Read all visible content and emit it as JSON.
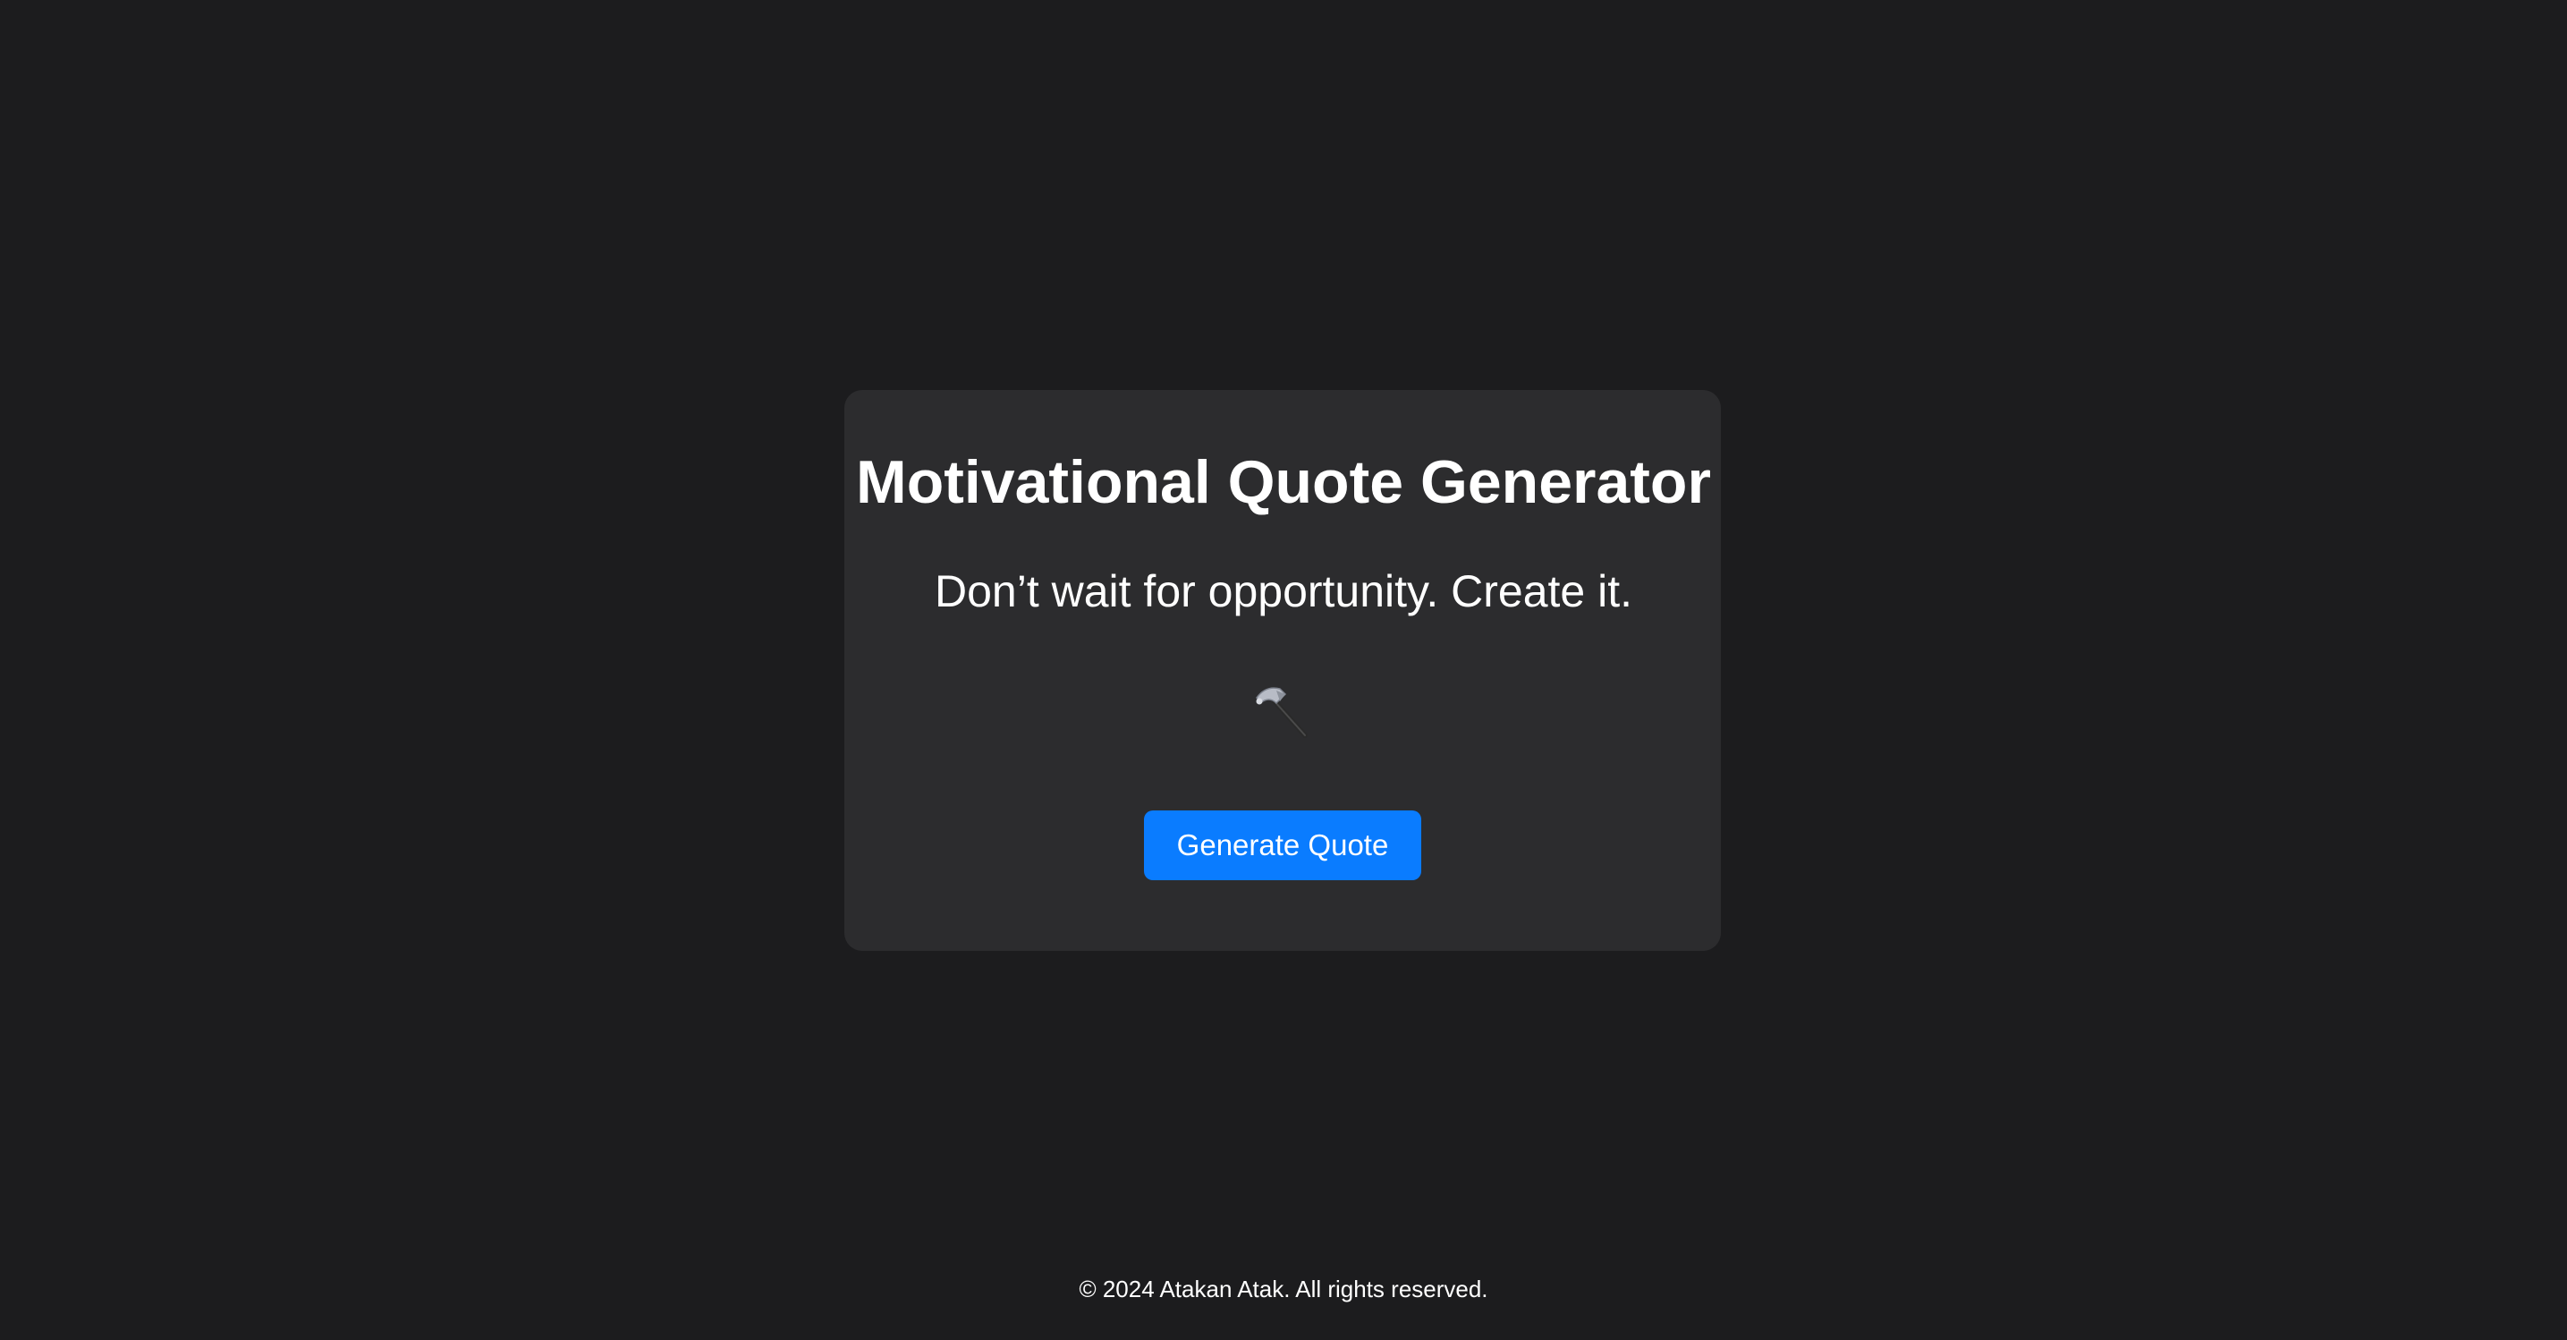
{
  "header": {
    "title": "Motivational Quote Generator"
  },
  "quote": {
    "text": "Don’t wait for opportunity. Create it.",
    "icon": "hammer-icon"
  },
  "actions": {
    "generate_label": "Generate Quote"
  },
  "footer": {
    "copyright": "© 2024 Atakan Atak. All rights reserved."
  },
  "colors": {
    "background": "#1c1c1e",
    "card": "#2c2c2e",
    "accent": "#0a7cff",
    "text": "#ffffff"
  }
}
